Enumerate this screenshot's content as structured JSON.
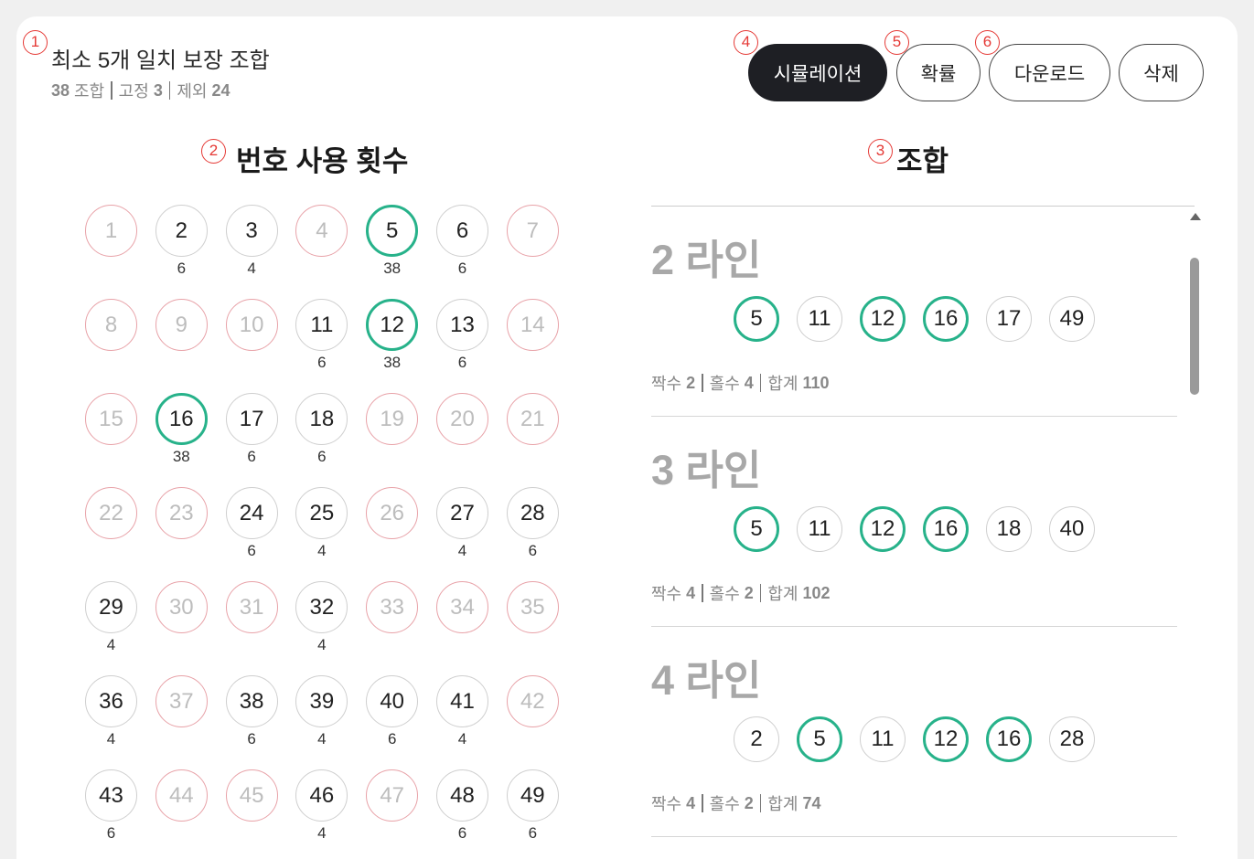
{
  "header": {
    "title": "최소 5개 일치 보장 조합",
    "meta": [
      {
        "value": "38",
        "label": "조합"
      },
      {
        "label": "고정",
        "value": "3"
      },
      {
        "label": "제외",
        "value": "24"
      }
    ]
  },
  "markers": [
    "1",
    "2",
    "3",
    "4",
    "5",
    "6"
  ],
  "toolbar": {
    "simulation_label": "시뮬레이션",
    "probability_label": "확률",
    "download_label": "다운로드",
    "delete_label": "삭제"
  },
  "usage": {
    "title": "번호 사용 횟수",
    "numbers": [
      {
        "n": "1",
        "state": "excluded",
        "count": ""
      },
      {
        "n": "2",
        "state": "normal",
        "count": "6"
      },
      {
        "n": "3",
        "state": "normal",
        "count": "4"
      },
      {
        "n": "4",
        "state": "excluded",
        "count": ""
      },
      {
        "n": "5",
        "state": "fixed",
        "count": "38"
      },
      {
        "n": "6",
        "state": "normal",
        "count": "6"
      },
      {
        "n": "7",
        "state": "excluded",
        "count": ""
      },
      {
        "n": "8",
        "state": "excluded",
        "count": ""
      },
      {
        "n": "9",
        "state": "excluded",
        "count": ""
      },
      {
        "n": "10",
        "state": "excluded",
        "count": ""
      },
      {
        "n": "11",
        "state": "normal",
        "count": "6"
      },
      {
        "n": "12",
        "state": "fixed",
        "count": "38"
      },
      {
        "n": "13",
        "state": "normal",
        "count": "6"
      },
      {
        "n": "14",
        "state": "excluded",
        "count": ""
      },
      {
        "n": "15",
        "state": "excluded",
        "count": ""
      },
      {
        "n": "16",
        "state": "fixed",
        "count": "38"
      },
      {
        "n": "17",
        "state": "normal",
        "count": "6"
      },
      {
        "n": "18",
        "state": "normal",
        "count": "6"
      },
      {
        "n": "19",
        "state": "excluded",
        "count": ""
      },
      {
        "n": "20",
        "state": "excluded",
        "count": ""
      },
      {
        "n": "21",
        "state": "excluded",
        "count": ""
      },
      {
        "n": "22",
        "state": "excluded",
        "count": ""
      },
      {
        "n": "23",
        "state": "excluded",
        "count": ""
      },
      {
        "n": "24",
        "state": "normal",
        "count": "6"
      },
      {
        "n": "25",
        "state": "normal",
        "count": "4"
      },
      {
        "n": "26",
        "state": "excluded",
        "count": ""
      },
      {
        "n": "27",
        "state": "normal",
        "count": "4"
      },
      {
        "n": "28",
        "state": "normal",
        "count": "6"
      },
      {
        "n": "29",
        "state": "normal",
        "count": "4"
      },
      {
        "n": "30",
        "state": "excluded",
        "count": ""
      },
      {
        "n": "31",
        "state": "excluded",
        "count": ""
      },
      {
        "n": "32",
        "state": "normal",
        "count": "4"
      },
      {
        "n": "33",
        "state": "excluded",
        "count": ""
      },
      {
        "n": "34",
        "state": "excluded",
        "count": ""
      },
      {
        "n": "35",
        "state": "excluded",
        "count": ""
      },
      {
        "n": "36",
        "state": "normal",
        "count": "4"
      },
      {
        "n": "37",
        "state": "excluded",
        "count": ""
      },
      {
        "n": "38",
        "state": "normal",
        "count": "6"
      },
      {
        "n": "39",
        "state": "normal",
        "count": "4"
      },
      {
        "n": "40",
        "state": "normal",
        "count": "6"
      },
      {
        "n": "41",
        "state": "normal",
        "count": "4"
      },
      {
        "n": "42",
        "state": "excluded",
        "count": ""
      },
      {
        "n": "43",
        "state": "normal",
        "count": "6"
      },
      {
        "n": "44",
        "state": "excluded",
        "count": ""
      },
      {
        "n": "45",
        "state": "excluded",
        "count": ""
      },
      {
        "n": "46",
        "state": "normal",
        "count": "4"
      },
      {
        "n": "47",
        "state": "excluded",
        "count": ""
      },
      {
        "n": "48",
        "state": "normal",
        "count": "6"
      },
      {
        "n": "49",
        "state": "normal",
        "count": "6"
      }
    ]
  },
  "combinations": {
    "title": "조합",
    "lines": [
      {
        "title": "2 라인",
        "numbers": [
          {
            "n": "5",
            "fixed": true
          },
          {
            "n": "11",
            "fixed": false
          },
          {
            "n": "12",
            "fixed": true
          },
          {
            "n": "16",
            "fixed": true
          },
          {
            "n": "17",
            "fixed": false
          },
          {
            "n": "49",
            "fixed": false
          }
        ],
        "stats": [
          {
            "label": "짝수",
            "value": "2"
          },
          {
            "label": "홀수",
            "value": "4"
          },
          {
            "label": "합계",
            "value": "110"
          }
        ]
      },
      {
        "title": "3 라인",
        "numbers": [
          {
            "n": "5",
            "fixed": true
          },
          {
            "n": "11",
            "fixed": false
          },
          {
            "n": "12",
            "fixed": true
          },
          {
            "n": "16",
            "fixed": true
          },
          {
            "n": "18",
            "fixed": false
          },
          {
            "n": "40",
            "fixed": false
          }
        ],
        "stats": [
          {
            "label": "짝수",
            "value": "4"
          },
          {
            "label": "홀수",
            "value": "2"
          },
          {
            "label": "합계",
            "value": "102"
          }
        ]
      },
      {
        "title": "4 라인",
        "numbers": [
          {
            "n": "2",
            "fixed": false
          },
          {
            "n": "5",
            "fixed": true
          },
          {
            "n": "11",
            "fixed": false
          },
          {
            "n": "12",
            "fixed": true
          },
          {
            "n": "16",
            "fixed": true
          },
          {
            "n": "28",
            "fixed": false
          }
        ],
        "stats": [
          {
            "label": "짝수",
            "value": "4"
          },
          {
            "label": "홀수",
            "value": "2"
          },
          {
            "label": "합계",
            "value": "74"
          }
        ]
      }
    ]
  },
  "colors": {
    "fixed_ring": "#27b28a",
    "excluded_ring": "#e8a2a8",
    "primary_button": "#1e1f24",
    "marker": "#e53935"
  }
}
